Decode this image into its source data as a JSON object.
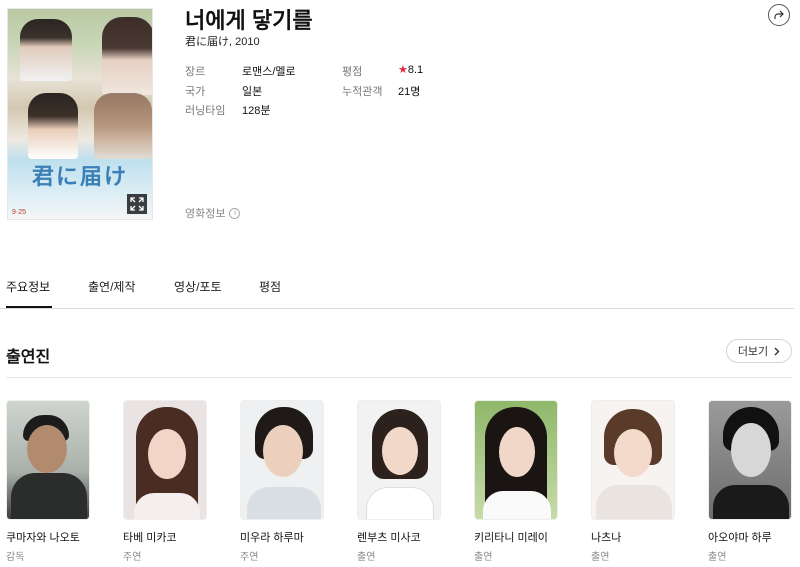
{
  "movie": {
    "title": "너에게 닿기를",
    "subtitle": "君に届け, 2010",
    "poster_title": "君に届け",
    "poster_date": "9·25",
    "info_link": "영화정보",
    "info_icon": "i"
  },
  "meta": {
    "genre_label": "장르",
    "genre_value": "로맨스/멜로",
    "country_label": "국가",
    "country_value": "일본",
    "runtime_label": "러닝타임",
    "runtime_value": "128분",
    "rating_label": "평점",
    "rating_value": "8.1",
    "audience_label": "누적관객",
    "audience_value": "21명"
  },
  "tabs": [
    "주요정보",
    "출연/제작",
    "영상/포토",
    "평점"
  ],
  "cast_section": {
    "title": "출연진",
    "more_label": "더보기"
  },
  "cast": [
    {
      "name": "쿠마자와 나오토",
      "role": "감독"
    },
    {
      "name": "타베 미카코",
      "role": "주연"
    },
    {
      "name": "미우라 하루마",
      "role": "주연"
    },
    {
      "name": "렌부츠 미사코",
      "role": "출연"
    },
    {
      "name": "키리타니 미레이",
      "role": "출연"
    },
    {
      "name": "나츠나",
      "role": "출연"
    },
    {
      "name": "아오야마 하루",
      "role": "출연"
    }
  ],
  "colors": {
    "star": "#e0293b",
    "poster_title": "#3a7fb5"
  },
  "icons": {
    "share": "share-icon",
    "expand": "expand-icon",
    "chevron": "chevron-right-icon",
    "star": "star-icon"
  }
}
